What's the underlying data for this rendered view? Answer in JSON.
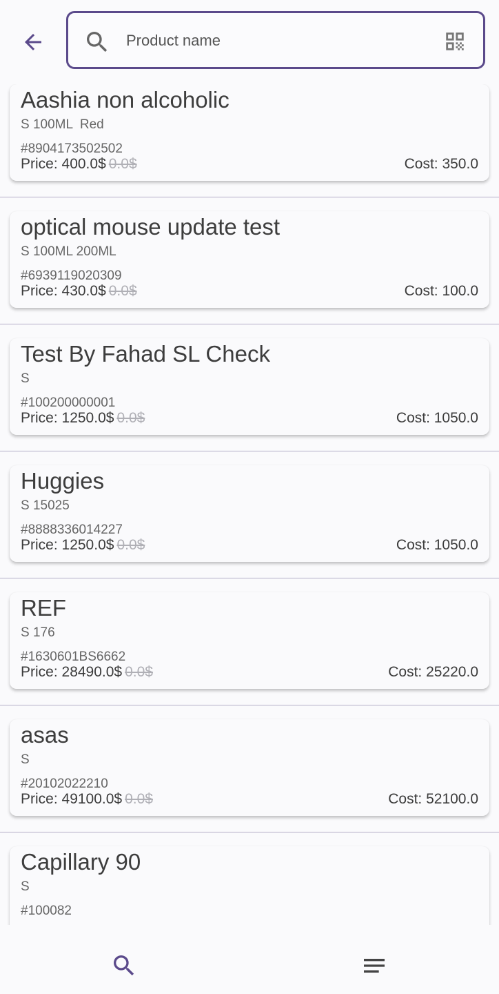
{
  "colors": {
    "accent": "#5b4a8b",
    "background": "#fafafc",
    "divider": "#b3adc7",
    "text": "#3b3b3b",
    "muted": "#666666"
  },
  "header": {
    "back_icon": "arrow-left-icon",
    "search": {
      "icon": "search-icon",
      "placeholder": "Product name",
      "value": "",
      "scan_icon": "qr-code-icon"
    }
  },
  "products": [
    {
      "name": "Aashia non alcoholic",
      "variant": "S 100ML  Red",
      "code": "#8904173502502",
      "price": "Price: 400.0$",
      "old_price": "0.0$",
      "cost": "Cost: 350.0"
    },
    {
      "name": "optical mouse update test",
      "variant": "S 100ML 200ML",
      "code": "#6939119020309",
      "price": "Price: 430.0$",
      "old_price": "0.0$",
      "cost": "Cost: 100.0"
    },
    {
      "name": "Test By Fahad SL Check",
      "variant": "S",
      "code": "#100200000001",
      "price": "Price: 1250.0$",
      "old_price": "0.0$",
      "cost": "Cost: 1050.0"
    },
    {
      "name": "Huggies",
      "variant": "S 15025",
      "code": "#8888336014227",
      "price": "Price: 1250.0$",
      "old_price": "0.0$",
      "cost": "Cost: 1050.0"
    },
    {
      "name": "REF",
      "variant": "S 176",
      "code": "#1630601BS6662",
      "price": "Price: 28490.0$",
      "old_price": "0.0$",
      "cost": "Cost: 25220.0"
    },
    {
      "name": "asas",
      "variant": "S",
      "code": "#20102022210",
      "price": "Price: 49100.0$",
      "old_price": "0.0$",
      "cost": "Cost: 52100.0"
    },
    {
      "name": "Capillary 90",
      "variant": "S",
      "code": "#100082",
      "price": "",
      "old_price": "",
      "cost": ""
    }
  ],
  "bottom_nav": {
    "items": [
      {
        "icon": "search-icon",
        "active": true
      },
      {
        "icon": "menu-icon",
        "active": false
      }
    ]
  }
}
